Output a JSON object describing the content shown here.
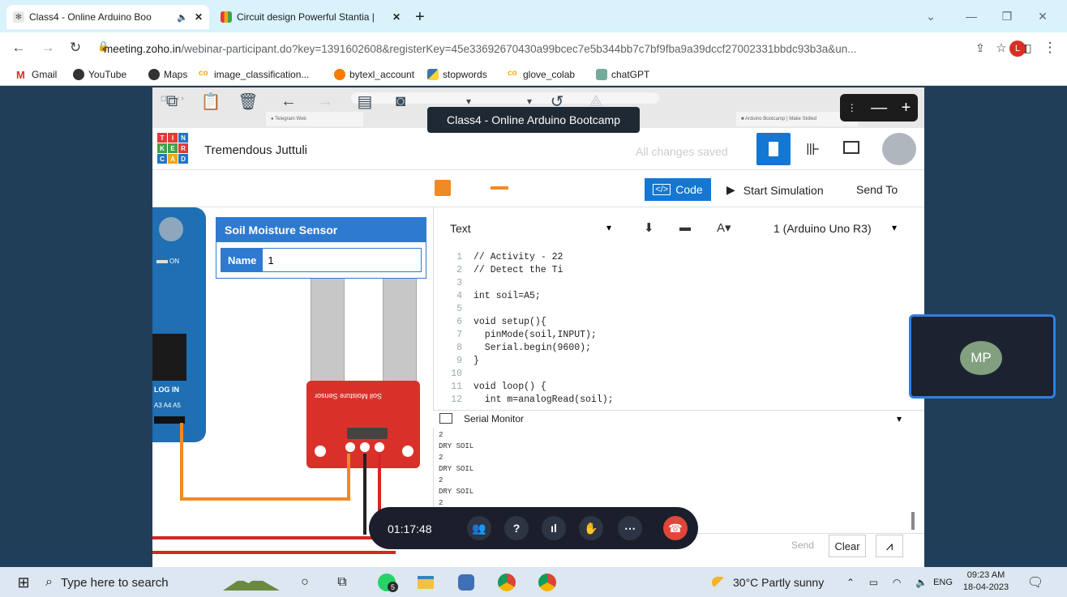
{
  "browser": {
    "tabs": [
      {
        "label": "Class4 - Online Arduino Boo",
        "active": true
      },
      {
        "label": "Circuit design Powerful Stantia |",
        "active": false
      }
    ],
    "url_host": "meeting.zoho.in",
    "url_path": "/webinar-participant.do?key=1391602608&registerKey=45e33692670430a99bcec7e5b344bb7c7bf9fba9a39dccf27002331bbdc93b3a&un...",
    "profile_initial": "L",
    "bookmarks": [
      "Gmail",
      "YouTube",
      "Maps",
      "image_classification...",
      "bytexl_account",
      "stopwords",
      "glove_colab",
      "chatGPT"
    ]
  },
  "webinar": {
    "title_tip": "Class4 - Online Arduino Bootcamp",
    "timer": "01:17:48",
    "participant_initials": "MP"
  },
  "tinkercad": {
    "logo": [
      "T",
      "I",
      "N",
      "K",
      "E",
      "R",
      "C",
      "A",
      "D"
    ],
    "project_name": "Tremendous Juttuli",
    "save_status": "All changes saved",
    "code_button": "Code",
    "start_simulation": "Start Simulation",
    "send_to": "Send To",
    "inspector": {
      "title": "Soil Moisture Sensor",
      "name_label": "Name",
      "name_value": "1"
    },
    "editor_mode": "Text",
    "board_select": "1 (Arduino Uno R3)",
    "board_labels": {
      "on": "ON",
      "log_in": "LOG IN",
      "pins": "A3 A4 A5"
    },
    "sensor_label": "Soil Moisture Sensor",
    "code_lines": [
      {
        "n": "1",
        "t": "// Activity - 22"
      },
      {
        "n": "2",
        "t": "// Detect the Ti"
      },
      {
        "n": "3",
        "t": ""
      },
      {
        "n": "4",
        "t": "int soil=A5;"
      },
      {
        "n": "5",
        "t": ""
      },
      {
        "n": "6",
        "t": "void setup(){"
      },
      {
        "n": "7",
        "t": "  pinMode(soil,INPUT);"
      },
      {
        "n": "8",
        "t": "  Serial.begin(9600);"
      },
      {
        "n": "9",
        "t": "}"
      },
      {
        "n": "10",
        "t": ""
      },
      {
        "n": "11",
        "t": "void loop() {"
      },
      {
        "n": "12",
        "t": "  int m=analogRead(soil);"
      }
    ],
    "serial_monitor": "Serial Monitor",
    "serial_lines": [
      "2",
      "DRY SOIL",
      "2",
      "DRY SOIL",
      "2",
      "DRY SOIL",
      "2"
    ],
    "send_button": "Send",
    "clear_button": "Clear"
  },
  "taskbar": {
    "search_placeholder": "Type here to search",
    "whatsapp_badge": "5",
    "weather": "30°C  Partly sunny",
    "language": "ENG",
    "time": "09:23 AM",
    "date": "18-04-2023"
  }
}
